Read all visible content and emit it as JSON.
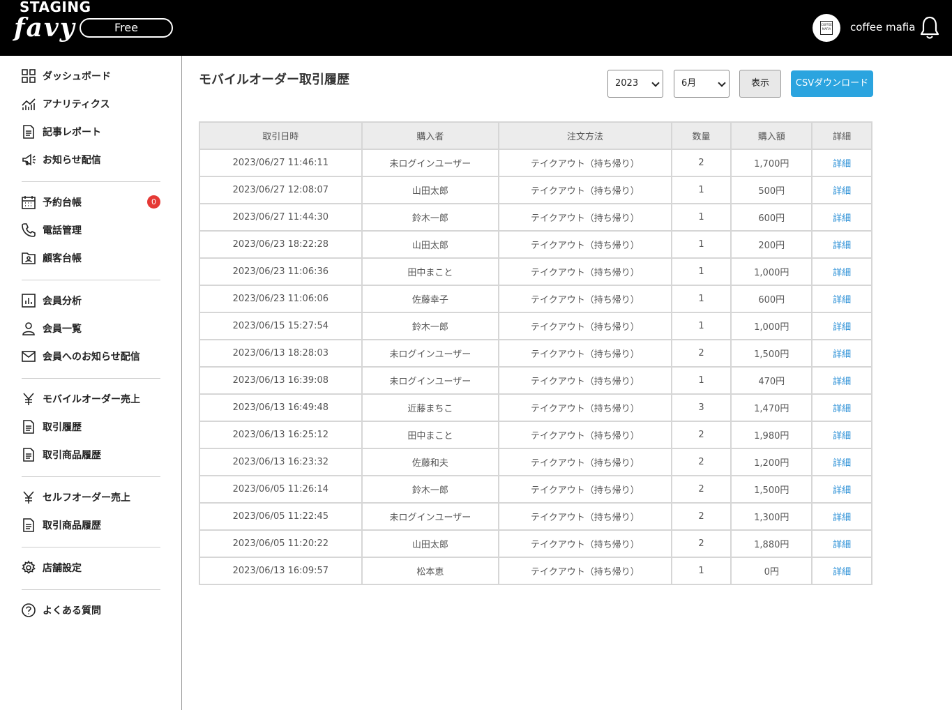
{
  "header": {
    "env_label": "STAGING",
    "logo_text": "favy",
    "plan_label": "Free",
    "avatar_text": "COFFEE MAFIA",
    "shop_name": "coffee mafia"
  },
  "sidebar": {
    "items": [
      {
        "label": "ダッシュボード",
        "icon": "grid-icon"
      },
      {
        "label": "アナリティクス",
        "icon": "chart-line-icon"
      },
      {
        "label": "記事レポート",
        "icon": "document-icon"
      },
      {
        "label": "お知らせ配信",
        "icon": "megaphone-icon"
      },
      {
        "label": "予約台帳",
        "icon": "calendar-icon",
        "badge": "0"
      },
      {
        "label": "電話管理",
        "icon": "phone-icon"
      },
      {
        "label": "顧客台帳",
        "icon": "folder-user-icon"
      },
      {
        "label": "会員分析",
        "icon": "bar-chart-icon"
      },
      {
        "label": "会員一覧",
        "icon": "user-icon"
      },
      {
        "label": "会員へのお知らせ配信",
        "icon": "mail-icon"
      },
      {
        "label": "モバイルオーダー売上",
        "icon": "yen-icon"
      },
      {
        "label": "取引履歴",
        "icon": "document-icon"
      },
      {
        "label": "取引商品履歴",
        "icon": "document-icon"
      },
      {
        "label": "セルフオーダー売上",
        "icon": "yen-icon"
      },
      {
        "label": "取引商品履歴",
        "icon": "document-icon"
      },
      {
        "label": "店舗設定",
        "icon": "gear-icon"
      },
      {
        "label": "よくある質問",
        "icon": "help-icon"
      }
    ]
  },
  "main": {
    "title": "モバイルオーダー取引履歴",
    "year_select": "2023",
    "month_select": "6月",
    "show_button": "表示",
    "csv_button": "CSVダウンロード",
    "table": {
      "headers": [
        "取引日時",
        "購入者",
        "注文方法",
        "数量",
        "購入額",
        "詳細"
      ],
      "rows": [
        [
          "2023/06/27 11:46:11",
          "未ログインユーザー",
          "テイクアウト（持ち帰り）",
          "2",
          "1,700円",
          "詳細"
        ],
        [
          "2023/06/27 12:08:07",
          "山田太郎",
          "テイクアウト（持ち帰り）",
          "1",
          "500円",
          "詳細"
        ],
        [
          "2023/06/27 11:44:30",
          "鈴木一郎",
          "テイクアウト（持ち帰り）",
          "1",
          "600円",
          "詳細"
        ],
        [
          "2023/06/23 18:22:28",
          "山田太郎",
          "テイクアウト（持ち帰り）",
          "1",
          "200円",
          "詳細"
        ],
        [
          "2023/06/23 11:06:36",
          "田中まこと",
          "テイクアウト（持ち帰り）",
          "1",
          "1,000円",
          "詳細"
        ],
        [
          "2023/06/23 11:06:06",
          "佐藤幸子",
          "テイクアウト（持ち帰り）",
          "1",
          "600円",
          "詳細"
        ],
        [
          "2023/06/15 15:27:54",
          "鈴木一郎",
          "テイクアウト（持ち帰り）",
          "1",
          "1,000円",
          "詳細"
        ],
        [
          "2023/06/13 18:28:03",
          "未ログインユーザー",
          "テイクアウト（持ち帰り）",
          "2",
          "1,500円",
          "詳細"
        ],
        [
          "2023/06/13 16:39:08",
          "未ログインユーザー",
          "テイクアウト（持ち帰り）",
          "1",
          "470円",
          "詳細"
        ],
        [
          "2023/06/13 16:49:48",
          "近藤まちこ",
          "テイクアウト（持ち帰り）",
          "3",
          "1,470円",
          "詳細"
        ],
        [
          "2023/06/13 16:25:12",
          "田中まこと",
          "テイクアウト（持ち帰り）",
          "2",
          "1,980円",
          "詳細"
        ],
        [
          "2023/06/13 16:23:32",
          "佐藤和夫",
          "テイクアウト（持ち帰り）",
          "2",
          "1,200円",
          "詳細"
        ],
        [
          "2023/06/05 11:26:14",
          "鈴木一郎",
          "テイクアウト（持ち帰り）",
          "2",
          "1,500円",
          "詳細"
        ],
        [
          "2023/06/05 11:22:45",
          "未ログインユーザー",
          "テイクアウト（持ち帰り）",
          "2",
          "1,300円",
          "詳細"
        ],
        [
          "2023/06/05 11:20:22",
          "山田太郎",
          "テイクアウト（持ち帰り）",
          "2",
          "1,880円",
          "詳細"
        ],
        [
          "2023/06/13 16:09:57",
          "松本恵",
          "テイクアウト（持ち帰り）",
          "1",
          "0円",
          "詳細"
        ]
      ]
    }
  },
  "colors": {
    "header_bg": "#000000",
    "accent": "#2ba4df",
    "link": "#2a8fd6",
    "badge": "#e53935"
  }
}
